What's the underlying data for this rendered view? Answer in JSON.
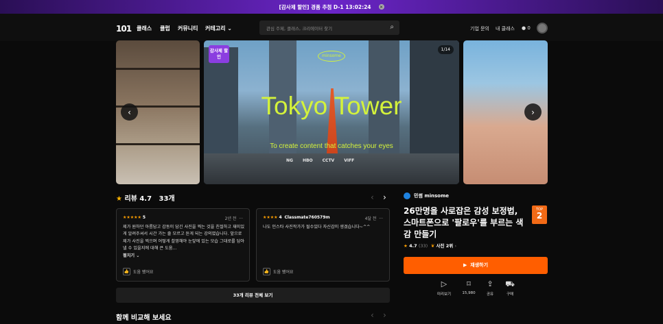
{
  "promo": {
    "text": "[감사제 할인] 경품 추첨  D-1  13:02:24",
    "close": "×"
  },
  "nav": {
    "logo": "101",
    "items": [
      "클래스",
      "클럽",
      "커뮤니티",
      "커테고리"
    ],
    "search_placeholder": "관심 주제, 클래스, 크리에이터 찾기",
    "enterprise": "기업 문의",
    "my_class": "내 클래스",
    "points": "0"
  },
  "carousel": {
    "badge": "감사제 할인",
    "counter": "1/14",
    "brand": "minsome",
    "title": "Tokyo Tower",
    "subtitle": "To create content that catches your eyes",
    "logos": [
      "NG",
      "HBO",
      "CCTV",
      "VIFF"
    ],
    "prev": "‹",
    "next": "›"
  },
  "reviews": {
    "title": "리뷰",
    "score": "4.7",
    "count": "33개",
    "cards": [
      {
        "stars": "★★★★★",
        "score": "5",
        "date": "2년 전",
        "text": "제가 원하던 아름답고 감동이 담긴 사진을 찍는 것을 친절하고 재미있게 알려주셔서 시간 가는 줄 모르고 듣게 되는 강의였습니다. 앞으로 제가 사진을 찍으며 어떻게 촬영해야 눈앞에 있는 모습 그대로를 담아낼 수 있을지에 대해 큰 도움...",
        "more": "펼치기",
        "help": "도움 됐어요"
      },
      {
        "stars": "★★★★",
        "score": "4",
        "user": "Classmate760579m",
        "date": "4달 전",
        "text": "나도 인스타 사진작가가 될수있다 자신감이 생겼습니다~^^",
        "help": "도움 됐어요"
      }
    ],
    "all_button": "33개 리뷰 전체 보기"
  },
  "compare_title": "함께 비교해 보세요",
  "course": {
    "creator": "민썸 minsome",
    "title": "26만명을 사로잡은 감성 보정법, 스마트폰으로 '팔로우'를 부르는 색감 만들기",
    "top_label": "TOP",
    "top_rank": "2",
    "rating": "4.7",
    "rating_count": "(33)",
    "photo_rank": "사진 2위",
    "play": "재생하기",
    "actions": [
      {
        "icon": "play-circle-icon",
        "glyph": "▷",
        "label": "미리보기"
      },
      {
        "icon": "bookmark-icon",
        "glyph": "⌑",
        "label": "15,980"
      },
      {
        "icon": "share-icon",
        "glyph": "⇪",
        "label": "공유"
      },
      {
        "icon": "cart-icon",
        "glyph": "⛟",
        "label": "구매"
      }
    ]
  }
}
